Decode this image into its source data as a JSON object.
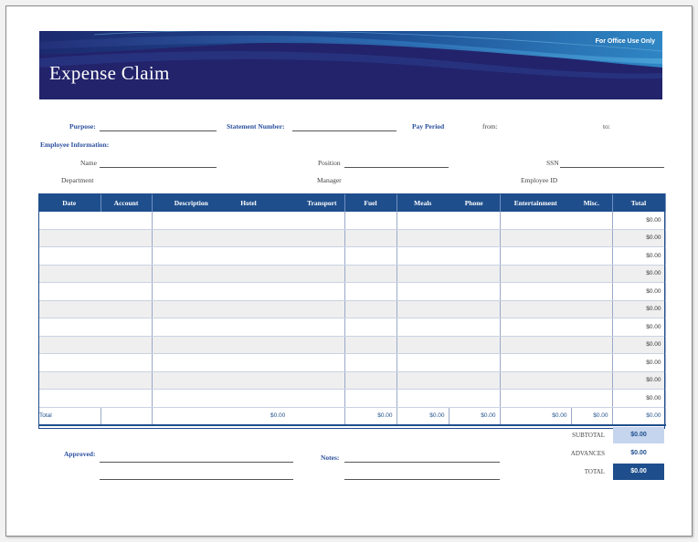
{
  "banner": {
    "title": "Expense Claim",
    "office_note": "For Office Use Only"
  },
  "header_fields": {
    "purpose": "Purpose:",
    "statement_number": "Statement Number:",
    "pay_period": "Pay Period",
    "from": "from:",
    "to": "to:",
    "employee_info": "Employee Information:",
    "name": "Name",
    "position": "Position",
    "ssn": "SSN",
    "department": "Department",
    "manager": "Manager",
    "employee_id": "Employee ID"
  },
  "table": {
    "columns": [
      "Date",
      "Account",
      "Description",
      "Hotel",
      "Transport",
      "Fuel",
      "Meals",
      "Phone",
      "Entertainment",
      "Misc.",
      "Total"
    ],
    "row_totals": [
      "$0.00",
      "$0.00",
      "$0.00",
      "$0.00",
      "$0.00",
      "$0.00",
      "$0.00",
      "$0.00",
      "$0.00",
      "$0.00",
      "$0.00"
    ],
    "total_row": {
      "label": "Total",
      "hotel": "$0.00",
      "transport": "$0.00",
      "fuel": "$0.00",
      "meals": "$0.00",
      "phone": "$0.00",
      "entertainment": "$0.00",
      "misc": "$0.00",
      "total": "$0.00"
    }
  },
  "summary": {
    "subtotal_label": "SUBTOTAL",
    "subtotal_value": "$0.00",
    "advances_label": "ADVANCES",
    "advances_value": "$0.00",
    "total_label": "TOTAL",
    "total_value": "$0.00"
  },
  "footer": {
    "approved": "Approved:",
    "notes": "Notes:"
  },
  "colors": {
    "header_blue": "#1e4e8c",
    "banner_dark": "#22236b",
    "label_blue": "#2b4f9e",
    "subtotal_fill": "#c5d5ee"
  }
}
